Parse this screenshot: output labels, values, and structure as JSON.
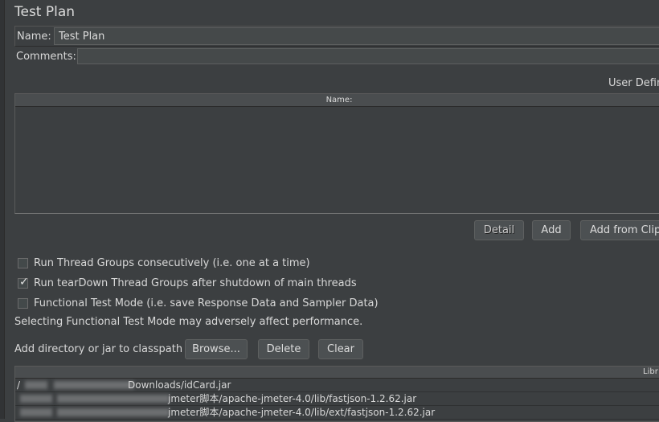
{
  "title": "Test Plan",
  "name_field": {
    "label": "Name:",
    "value": "Test Plan"
  },
  "comments_label": "Comments:",
  "udv_label": "User Defin",
  "vars_table": {
    "column_name": "Name:"
  },
  "table_buttons": {
    "detail": "Detail",
    "add": "Add",
    "add_from_clipboard": "Add from Clip"
  },
  "options": [
    {
      "label": "Run Thread Groups consecutively (i.e. one at a time)",
      "checked": false
    },
    {
      "label": "Run tearDown Thread Groups after shutdown of main threads",
      "checked": true
    },
    {
      "label": "Functional Test Mode (i.e. save Response Data and Sampler Data)",
      "checked": false
    }
  ],
  "warning": "Selecting Functional Test Mode may adversely affect performance.",
  "classpath": {
    "label": "Add directory or jar to classpath",
    "browse": "Browse...",
    "delete": "Delete",
    "clear": "Clear"
  },
  "library": {
    "header": "Libr",
    "rows": [
      {
        "prefix": "/",
        "visible": "Downloads/idCard.jar"
      },
      {
        "prefix": "",
        "visible": "jmeter脚本/apache-jmeter-4.0/lib/fastjson-1.2.62.jar"
      },
      {
        "prefix": "",
        "visible": "jmeter脚本/apache-jmeter-4.0/lib/ext/fastjson-1.2.62.jar"
      }
    ]
  }
}
